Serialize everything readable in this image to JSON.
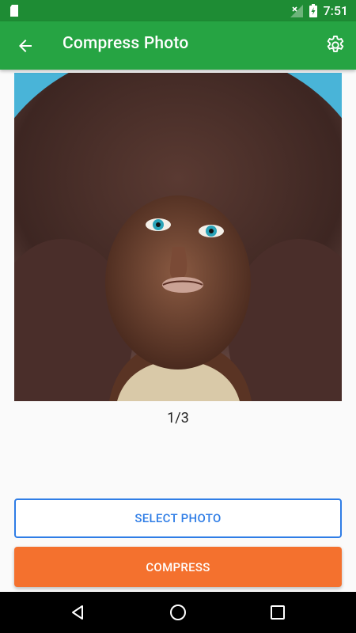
{
  "status_bar": {
    "time": "7:51",
    "icons": [
      "sim-card-icon",
      "no-signal-icon",
      "battery-charging-icon"
    ]
  },
  "app_bar": {
    "title": "Compress Photo",
    "icons": [
      "arrow-back-icon",
      "settings-gear-icon"
    ]
  },
  "photo": {
    "description_icon": "photo-preview"
  },
  "counter": "1/3",
  "buttons": {
    "select_label": "SELECT PHOTO",
    "compress_label": "COMPRESS"
  },
  "colors": {
    "status_bar": "#1e8c34",
    "app_bar": "#26a443",
    "select_accent": "#2f7de6",
    "compress_bg": "#f4712e"
  },
  "nav_bar": {
    "icons": [
      "nav-back-icon",
      "nav-home-icon",
      "nav-recents-icon"
    ]
  }
}
